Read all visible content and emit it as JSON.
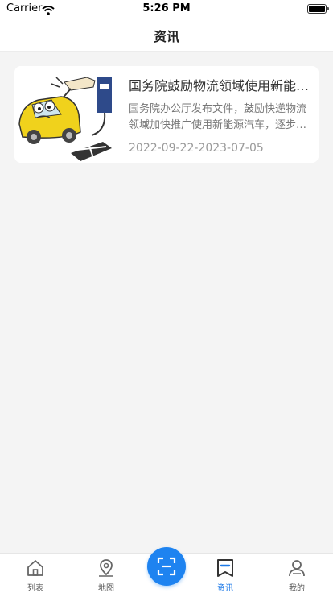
{
  "status_bar": {
    "carrier": "Carrier",
    "time": "5:26 PM"
  },
  "header": {
    "title": "资讯"
  },
  "news": [
    {
      "title": "国务院鼓励物流领域使用新能源汽车",
      "summary": "国务院办公厅发布文件，鼓励快递物流领域加快推广使用新能源汽车，逐步提高新能源汽车使用比例",
      "date": "2022-09-22-2023-07-05",
      "image": "cartoon-electric-car-plug"
    }
  ],
  "tab_bar": {
    "items": [
      {
        "label": "列表",
        "icon": "home-icon",
        "active": false
      },
      {
        "label": "地图",
        "icon": "map-pin-icon",
        "active": false
      },
      {
        "label": "资讯",
        "icon": "news-bookmark-icon",
        "active": true
      },
      {
        "label": "我的",
        "icon": "user-icon",
        "active": false
      }
    ],
    "center_button_icon": "scan-icon"
  },
  "colors": {
    "accent": "#1e83f0",
    "background": "#f4f4f4",
    "card": "#ffffff"
  }
}
